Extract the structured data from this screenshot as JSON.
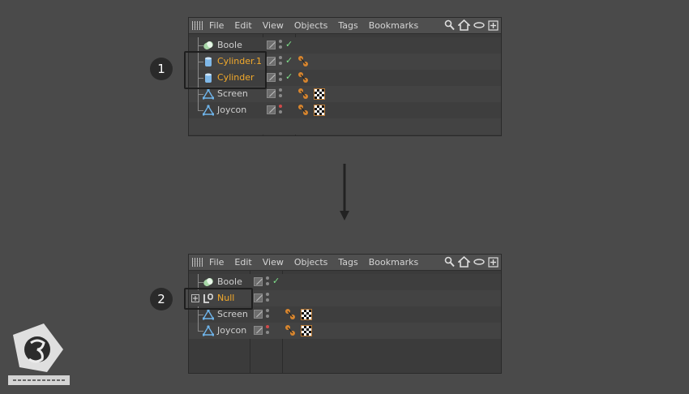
{
  "menu": {
    "items": [
      "File",
      "Edit",
      "View",
      "Objects",
      "Tags",
      "Bookmarks"
    ]
  },
  "panel1": {
    "rows": [
      {
        "name": "Boole",
        "icon": "boole-icon",
        "selected": false,
        "check": true,
        "red": false,
        "tags": []
      },
      {
        "name": "Cylinder.1",
        "icon": "cylinder-icon",
        "selected": true,
        "check": true,
        "red": false,
        "tags": [
          "phong"
        ]
      },
      {
        "name": "Cylinder",
        "icon": "cylinder-icon",
        "selected": true,
        "check": true,
        "red": false,
        "tags": [
          "phong"
        ]
      },
      {
        "name": "Screen",
        "icon": "polygon-icon",
        "selected": false,
        "check": false,
        "red": false,
        "tags": [
          "phong",
          "material"
        ]
      },
      {
        "name": "Joycon",
        "icon": "polygon-icon",
        "selected": false,
        "check": false,
        "red": true,
        "tags": [
          "phong",
          "material"
        ]
      }
    ]
  },
  "panel2": {
    "rows": [
      {
        "name": "Boole",
        "icon": "boole-icon",
        "selected": false,
        "check": true,
        "red": false,
        "tags": []
      },
      {
        "name": "Null",
        "icon": "null-icon",
        "selected": true,
        "check": false,
        "red": false,
        "tags": [],
        "expand": true
      },
      {
        "name": "Screen",
        "icon": "polygon-icon",
        "selected": false,
        "check": false,
        "red": false,
        "tags": [
          "phong",
          "material"
        ]
      },
      {
        "name": "Joycon",
        "icon": "polygon-icon",
        "selected": false,
        "check": false,
        "red": true,
        "tags": [
          "phong",
          "material"
        ]
      }
    ]
  },
  "steps": [
    "1",
    "2"
  ],
  "colors": {
    "selected": "#f2a92b",
    "check": "#7fe08a",
    "tag": "#d7852e"
  }
}
